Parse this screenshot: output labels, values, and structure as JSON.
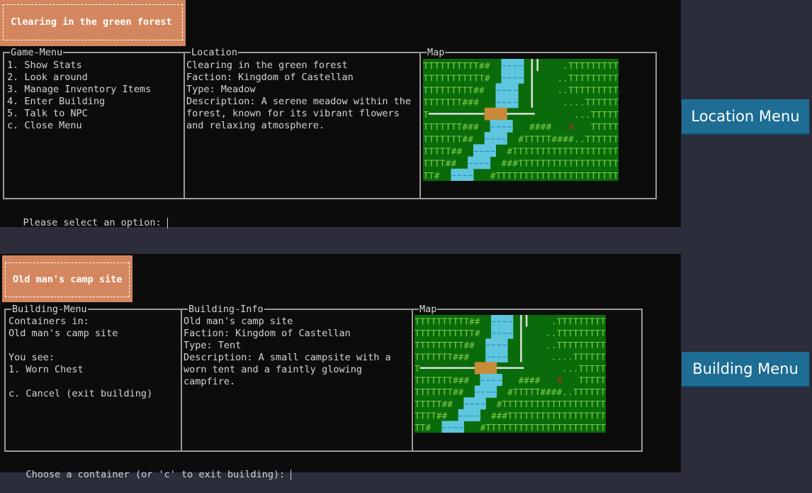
{
  "location_view": {
    "title": "Clearing in the green forest",
    "menu_title": "Game-Menu",
    "menu_items": [
      "1. Show Stats",
      "2. Look around",
      "3. Manage Inventory Items",
      "4. Enter Building",
      "5. Talk to NPC",
      "c. Close Menu"
    ],
    "info_title": "Location",
    "info_lines": [
      "Clearing in the green forest",
      "Faction: Kingdom of Castellan",
      "Type: Meadow",
      "Description: A serene meadow within the",
      "forest, known for its vibrant flowers",
      "and relaxing atmosphere."
    ],
    "map_title": "Map",
    "prompt": "Please select an option: "
  },
  "building_view": {
    "title": "Old man's camp site",
    "menu_title": "Building-Menu",
    "menu_items": [
      "Containers in:",
      "Old man's camp site",
      "",
      "You see:",
      "1. Worn Chest",
      "",
      "c. Cancel (exit building)"
    ],
    "info_title": "Building-Info",
    "info_lines": [
      "Old man's camp site",
      "Faction: Kingdom of Castellan",
      "Type: Tent",
      "Description: A small campsite with a",
      "worn tent and a faintly glowing",
      "campfire."
    ],
    "map_title": "Map",
    "prompt": "Choose a container (or 'c' to exit building): "
  },
  "side_buttons": {
    "location": "Location Menu",
    "building": "Building Menu"
  },
  "map_rows": [
    "TTTTTTTTTT##  ~~~~ ||    .TTTTTTTTT",
    "TTTTTTTTTTT#  ~~~~ |    ..TTTTTTTTT",
    "TTTTTTTTT##  ~~~~  |    ..TTTTTTTTT",
    "TTTTTTT###   ~~~~  |     ....TTTTTT",
    "T==========HHHH=====       ...TTTTT",
    "TTTTTTT###  ~~~~   ####   X   TTTTT",
    "TTTTTTT##  ~~~~  #TTTTT####..TTTTTT",
    "TTTTT##  ~~~~  #TTTTTTTTTTTTTTTTTTT",
    "TTTT##  ~~~~  ###TTTTTTTTTTTTTTTTTT",
    "TT#  ~~~~   #TTTTTTTTTTTTTTTTTTTTTT"
  ],
  "colors": {
    "map_bg": "#0a6b0a",
    "tree": "#7ed04a",
    "bush": "#7ed04a",
    "water": "#5fc6df",
    "bridge": "#c98a3a",
    "marker": "#d81e1e",
    "title_bg": "#d4875f",
    "button_bg": "#1d6d94"
  }
}
